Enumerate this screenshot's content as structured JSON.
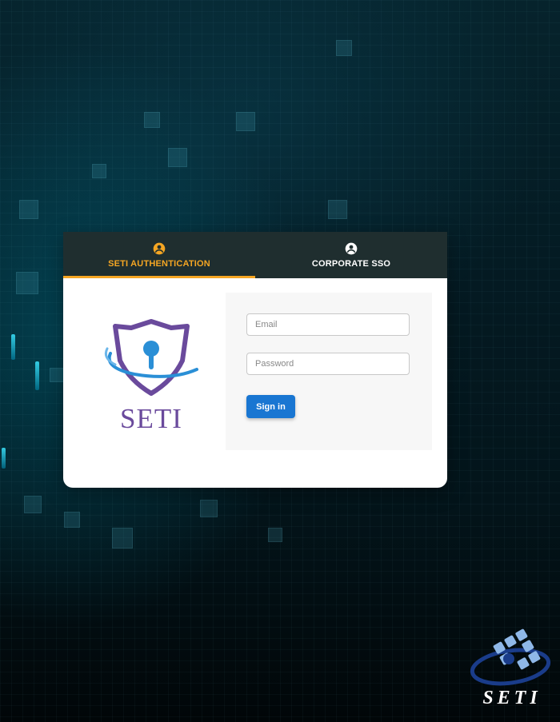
{
  "tabs": [
    {
      "label": "SETI AUTHENTICATION",
      "icon": "account-circle-icon",
      "active": true
    },
    {
      "label": "CORPORATE SSO",
      "icon": "account-circle-icon",
      "active": false
    }
  ],
  "brand": {
    "name": "SETI",
    "logo_icon": "shield-keyhole-icon",
    "color": "#6a4a9c"
  },
  "form": {
    "email_placeholder": "Email",
    "email_value": "",
    "password_placeholder": "Password",
    "password_value": "",
    "signin_label": "Sign in"
  },
  "corner_brand": {
    "name": "SETI"
  },
  "colors": {
    "accent": "#f5a623",
    "primary": "#1976d2",
    "tab_bar": "#1f2e2f"
  }
}
